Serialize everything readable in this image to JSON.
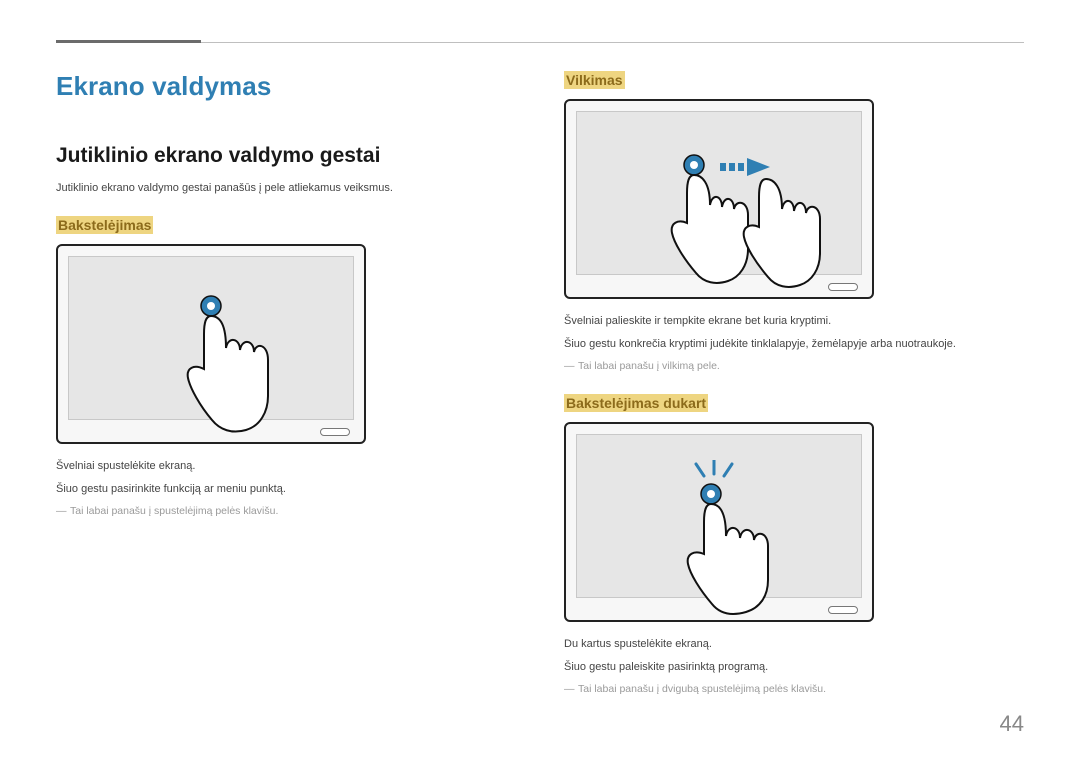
{
  "page_number": "44",
  "main_title": "Ekrano valdymas",
  "subtitle": "Jutiklinio ekrano valdymo gestai",
  "intro": "Jutiklinio ekrano valdymo gestai panašūs į pele atliekamus veiksmus.",
  "sections": {
    "tap": {
      "heading": "Bakstelėjimas",
      "desc1": "Švelniai spustelėkite ekraną.",
      "desc2": "Šiuo gestu pasirinkite funkciją ar meniu punktą.",
      "note": "Tai labai panašu į spustelėjimą pelės klavišu."
    },
    "drag": {
      "heading": "Vilkimas",
      "desc1": "Švelniai palieskite ir tempkite ekrane bet kuria kryptimi.",
      "desc2": "Šiuo gestu konkrečia kryptimi judėkite tinklalapyje, žemėlapyje arba nuotraukoje.",
      "note": "Tai labai panašu į vilkimą pele."
    },
    "doubletap": {
      "heading": "Bakstelėjimas dukart",
      "desc1": "Du kartus spustelėkite ekraną.",
      "desc2": "Šiuo gestu paleiskite pasirinktą programą.",
      "note": "Tai labai panašu į dvigubą spustelėjimą pelės klavišu."
    }
  }
}
